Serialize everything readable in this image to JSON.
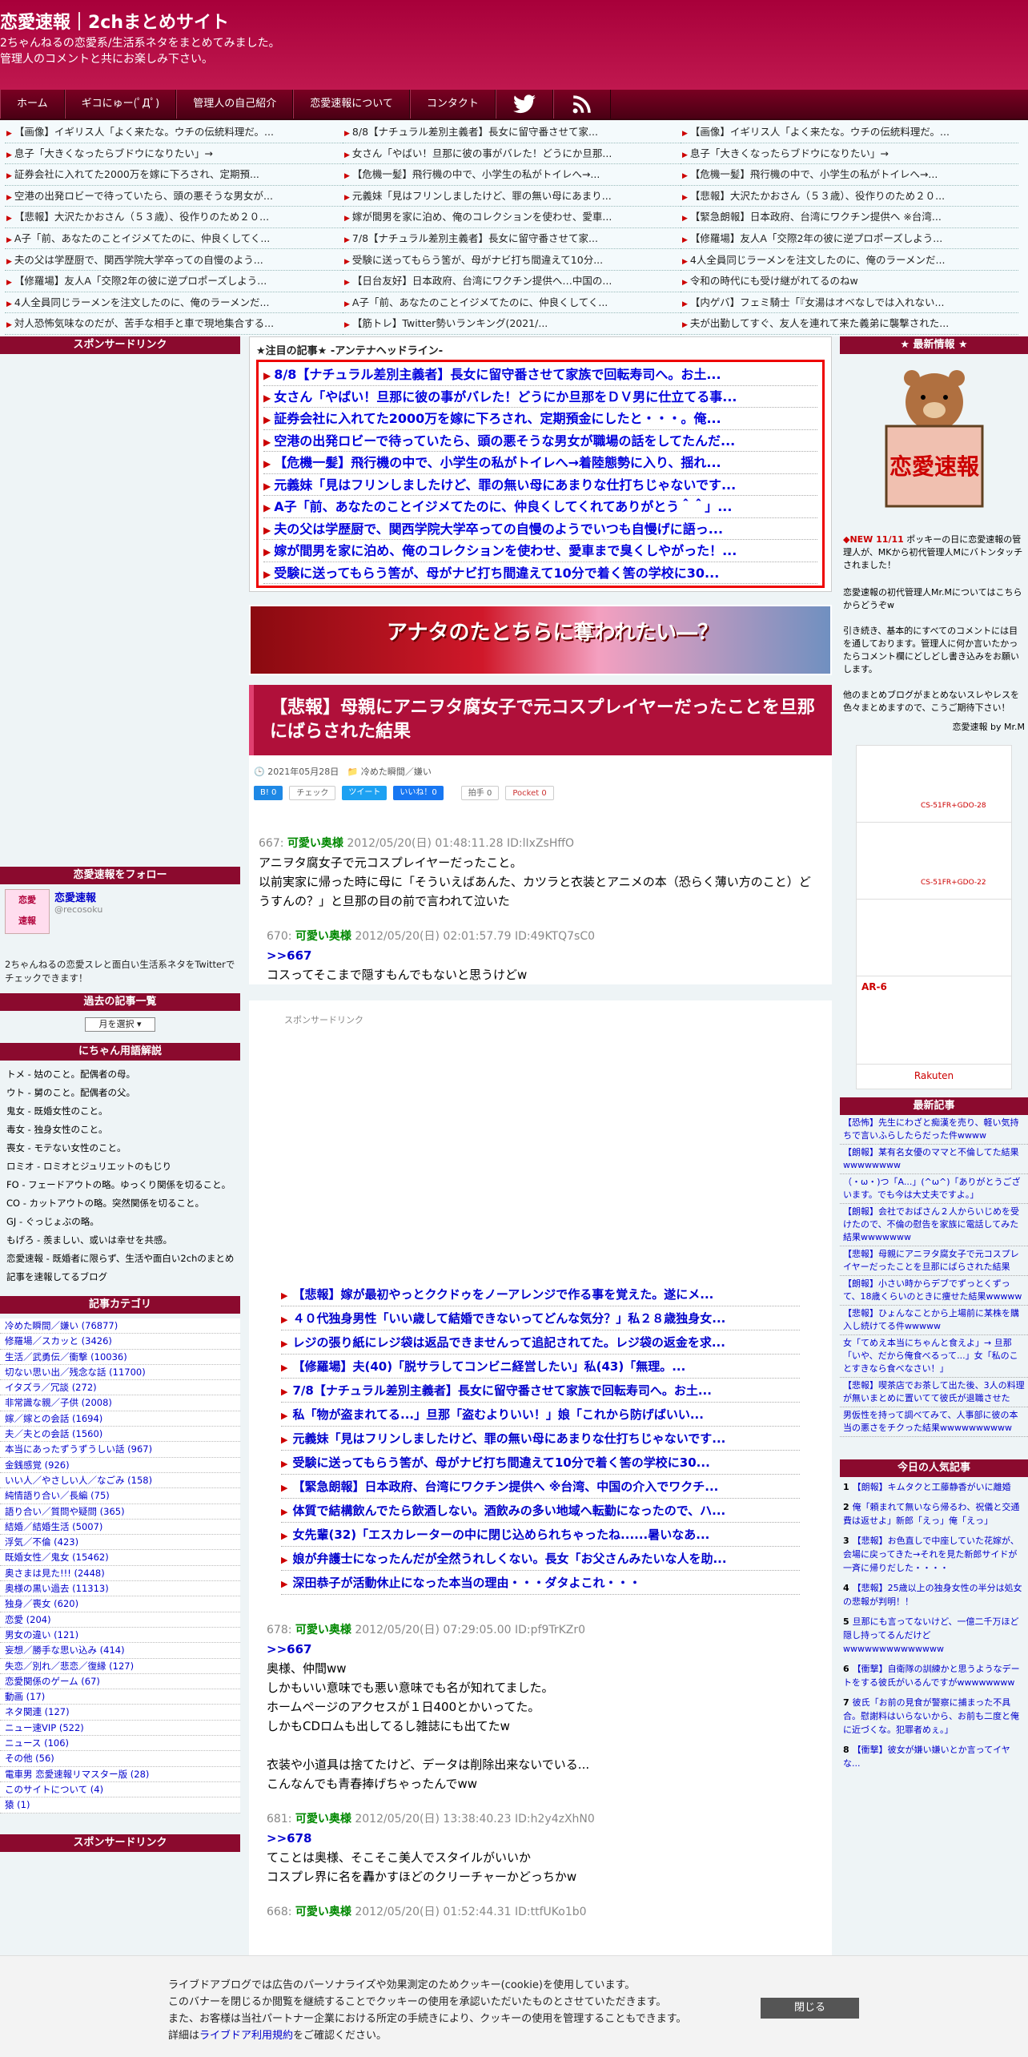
{
  "site": {
    "title": "恋愛速報｜2chまとめサイト",
    "desc1": "2ちゃんねるの恋愛系/生活系ネタをまとめてみました。",
    "desc2": "管理人のコメントと共にお楽しみ下さい。"
  },
  "nav": [
    "ホーム",
    "ギコにゅー(ﾟДﾟ)",
    "管理人の自己紹介",
    "恋愛速報について",
    "コンタクト"
  ],
  "ticker": [
    "【画像】イギリス人「よく来たな。ウチの伝統料理だ。...",
    "8/8【ナチュラル差別主義者】長女に留守番させて家...",
    "【画像】イギリス人「よく来たな。ウチの伝統料理だ。...",
    "息子「大きくなったらブドウになりたい」→",
    "女さん「やばい！旦那に彼の事がバレた！どうにか旦那...",
    "息子「大きくなったらブドウになりたい」→",
    "証券会社に入れてた2000万を嫁に下ろされ、定期預...",
    "【危機一髪】飛行機の中で、小学生の私がトイレへ→...",
    "【危機一髪】飛行機の中で、小学生の私がトイレへ→...",
    "空港の出発ロビーで待っていたら、頭の悪そうな男女が...",
    "元義妹「見はフリンしましたけど、罪の無い母にあまり...",
    "【悲報】大沢たかおさん（５３歳）、役作りのため２０...",
    "【悲報】大沢たかおさん（５３歳）、役作りのため２０...",
    "嫁が間男を家に泊め、俺のコレクションを使わせ、愛車...",
    "【緊急朗報】日本政府、台湾にワクチン提供へ ※台湾...",
    "A子「前、あなたのことイジメてたのに、仲良くしてく...",
    "7/8【ナチュラル差別主義者】長女に留守番させて家...",
    "【修羅場】友人A「交際2年の彼に逆プロポーズしよう...",
    "夫の父は学歴厨で、関西学院大学卒っての自慢のよう...",
    "受験に送ってもらう筈が、母がナビ打ち間違えて10分...",
    "4人全員同じラーメンを注文したのに、俺のラーメンだ...",
    "【修羅場】友人A「交際2年の彼に逆プロポーズしよう...",
    "【日台友好】日本政府、台湾にワクチン提供へ…中国の...",
    "令和の時代にも受け継がれてるのねw",
    "4人全員同じラーメンを注文したのに、俺のラーメンだ...",
    "A子「前、あなたのことイジメてたのに、仲良くしてく...",
    "【内ゲバ】フェミ騎士「『女湯はオベなしでは入れない...",
    "対人恐怖気味なのだが、苦手な相手と車で現地集合する...",
    "【筋トレ】Twitter勢いランキング(2021/...",
    "夫が出勤してすぐ、友人を連れて来た義弟に襲撃された..."
  ],
  "left": {
    "sponsor": "スポンサードリンク",
    "follow": "恋愛速報をフォロー",
    "acct_name": "恋愛速報",
    "acct_id": "@recosoku",
    "follow_desc": "2ちゃんねるの恋愛スレと面白い生活系ネタをTwitterでチェックできます！",
    "archive": "過去の記事一覧",
    "month_select": "月を選択",
    "glossary": "にちゃん用語解説",
    "terms": [
      "トメ - 姑のこと。配偶者の母。",
      "ウト - 舅のこと。配偶者の父。",
      "鬼女 - 既婚女性のこと。",
      "毒女 - 独身女性のこと。",
      "喪女 - モテない女性のこと。",
      "ロミオ - ロミオとジュリエットのもじり",
      "FO - フェードアウトの略。ゆっくり関係を切ること。",
      "CO - カットアウトの略。突然関係を切ること。",
      "GJ - ぐっじょぶの略。",
      "もげろ - 羨ましい、或いは幸せを共感。",
      "恋愛速報 - 既婚者に限らず、生活や面白い2chのまとめ記事を速報してるブログ"
    ],
    "category": "記事カテゴリ",
    "cats": [
      "冷めた瞬間／嫌い (76877)",
      "修羅場／スカッと (3426)",
      "生活／武勇伝／衝撃 (10036)",
      "切ない思い出／残念な話 (11700)",
      "イタズラ／冗談 (272)",
      "非常識な親／子供 (2008)",
      "嫁／嫁との会話 (1694)",
      "夫／夫との会話 (1560)",
      "本当にあったずうずうしい話 (967)",
      "金銭感覚 (926)",
      "いい人／やさしい人／なごみ (158)",
      "純情語り合い／長編 (75)",
      "語り合い／質問や疑問 (365)",
      "結婚／結婚生活 (5007)",
      "浮気／不倫 (423)",
      "既婚女性／鬼女 (15462)",
      "奥さまは見た!!! (2448)",
      "奥様の黒い過去 (11313)",
      "独身／喪女 (620)",
      "恋愛 (204)",
      "男女の違い (121)",
      "妄想／勝手な思い込み (414)",
      "失恋／別れ／悲恋／復縁 (127)",
      "恋愛関係のゲーム (67)",
      "動画 (17)",
      "ネタ関連 (127)",
      "ニュー速VIP (522)",
      "ニュース (106)",
      "その他 (56)",
      "電車男 恋愛速報リマスター版 (28)",
      "このサイトについて (4)",
      "猿 (1)"
    ],
    "sponsor2": "スポンサードリンク"
  },
  "antena": {
    "head": "★注目の記事★ -アンテナヘッドライン-",
    "items": [
      "8/8【ナチュラル差別主義者】長女に留守番させて家族で回転寿司へ。お土...",
      "女さん「やばい！旦那に彼の事がバレた！どうにか旦那をＤＶ男に仕立てる事...",
      "証券会社に入れてた2000万を嫁に下ろされ、定期預金にしたと・・・。俺...",
      "空港の出発ロビーで待っていたら、頭の悪そうな男女が職場の話をしてたんだ...",
      "【危機一髪】飛行機の中で、小学生の私がトイレへ→着陸態勢に入り、揺れ...",
      "元義妹「見はフリンしましたけど、罪の無い母にあまりな仕打ちじゃないです...",
      "A子「前、あなたのことイジメてたのに、仲良くしてくれてありがとう＾＾」...",
      "夫の父は学歴厨で、関西学院大学卒っての自慢のようでいつも自慢げに語っ...",
      "嫁が間男を家に泊め、俺のコレクションを使わせ、愛車まで臭くしやがった！...",
      "受験に送ってもらう筈が、母がナビ打ち間違えて10分で着く筈の学校に30..."
    ]
  },
  "banner_text": "アナタのたとちらに奪われたい―？",
  "article": {
    "title": "【悲報】母親にアニヲタ腐女子で元コスプレイヤーだったことを旦那にばらされた結果",
    "date": "2021年05月28日",
    "category": "冷めた瞬間／嫌い",
    "b": "B! 0",
    "check": "チェック",
    "tweet": "ツイート",
    "like": "いいね！0",
    "hakushu": "拍手 0",
    "pocket": "Pocket 0"
  },
  "posts": [
    {
      "no": "667:",
      "name": "可愛い奥様",
      "date": "2012/05/20(日) 01:48:11.28 ID:lIxZsHffO",
      "ref": "",
      "lines": [
        "アニヲタ腐女子で元コスプレイヤーだったこと。",
        "以前実家に帰った時に母に「そういえばあんた、カツラと衣装とアニメの本（恐らく薄い方のこと）どうすんの？」と旦那の目の前で言われて泣いた"
      ]
    },
    {
      "no": "670:",
      "name": "可愛い奥様",
      "date": "2012/05/20(日) 02:01:57.79 ID:49KTQ7sC0",
      "ref": ">>667",
      "lines": [
        "コスってそこまで隠すもんでもないと思うけどw"
      ]
    }
  ],
  "ad_label": "スポンサードリンク",
  "mid_links": [
    "【悲報】嫁が最初やっとククドゥをノーアレンジで作る事を覚えた。遂にメ...",
    "４０代独身男性「いい歳して結婚できないってどんな気分？」私２８歳独身女...",
    "レジの張り紙にレジ袋は返品できませんって追記されてた。レジ袋の返金を求...",
    "【修羅場】夫(40)「脱サラしてコンビニ経営したい」私(43)「無理。...",
    "7/8【ナチュラル差別主義者】長女に留守番させて家族で回転寿司へ。お土...",
    "私「物が盗まれてる...」旦那「盗むよりいい！」娘「これから防げばいい...",
    "元義妹「見はフリンしましたけど、罪の無い母にあまりな仕打ちじゃないです...",
    "受験に送ってもらう筈が、母がナビ打ち間違えて10分で着く筈の学校に30...",
    "【緊急朗報】日本政府、台湾にワクチン提供へ ※台湾、中国の介入でワクチ...",
    "体質で結構飲んでたら飲酒しない。酒飲みの多い地域へ転勤になったので、ハ...",
    "女先輩(32)「エスカレーターの中に閉じ込められちゃったね......暑いなあ...",
    "娘が弁護士になったんだが全然うれしくない。長女「お父さんみたいな人を助...",
    "深田恭子が活動休止になった本当の理由・・・ダタよこれ・・・"
  ],
  "posts2": [
    {
      "no": "678:",
      "name": "可愛い奥様",
      "date": "2012/05/20(日) 07:29:05.00 ID:pf9TrKZr0",
      "ref": ">>667",
      "lines": [
        "奥様、仲間ww",
        "しかもいい意味でも悪い意味でも名が知れてました。",
        "ホームページのアクセスが１日400とかいってた。",
        "しかもCDロムも出してるし雑誌にも出てたw",
        "",
        "衣装や小道具は捨てたけど、データは削除出来ないでいる...",
        "こんなんでも青春捧げちゃったんでww"
      ]
    },
    {
      "no": "681:",
      "name": "可愛い奥様",
      "date": "2012/05/20(日) 13:38:40.23 ID:h2y4zXhN0",
      "ref": ">>678",
      "lines": [
        "てことは奥様、そこそこ美人でスタイルがいいか",
        "コスプレ界に名を轟かすほどのクリーチャーかどっちかw"
      ]
    },
    {
      "no": "668:",
      "name": "可愛い奥様",
      "date": "2012/05/20(日) 01:52:44.31 ID:ttfUKo1b0",
      "ref": "",
      "lines": []
    }
  ],
  "right": {
    "latest": "★ 最新情報 ★",
    "logo_text": "恋愛速報",
    "news_new": "◆NEW 11/11",
    "news_body": "ポッキーの日に恋愛速報の管理人が、MKから初代管理人Mにバトンタッチされました！",
    "intro1": "恋愛速報の初代管理人Mr.Mについてはこちらからどうぞw",
    "intro2": "引き続き、基本的にすべてのコメントには目を通しております。管理人に何か言いたかったらコメント欄にどしどし書き込みをお願いします。",
    "intro3": "他のまとめブログがまとめないスレやレスを色々まとめますので、こうご期待下さい！",
    "sign": "恋愛速報 by Mr.M",
    "products": [
      "CS-51FR+GDO-28",
      "CS-51FR+GDO-22",
      "AR-6",
      "Rakuten"
    ],
    "latest_posts": "最新記事",
    "new_items": [
      "【恐怖】先生にわざと痴漢を売り、軽い気持ちで言いふらしたらだった件wwww",
      "【朗報】某有名女優のママと不倫してた結果wwwwwwww",
      "（・ω・)つ「A...」(^ω^)「ありがとうございます。でも今は大丈夫ですよ。」",
      "【朗報】会社でおばさん２人からいじめを受けたので、不倫の慰告を家族に電話してみた結果wwwwwww",
      "【悲報】母親にアニヲタ腐女子で元コスプレイヤーだったことを旦那にばらされた結果",
      "【朗報】小さい時からデブでずっとくずって、18歳くらいのときに痩せた結果wwwww",
      "【悲報】ひょんなことから上場前に某株を購入し続けてる件wwwww",
      "女「てめえ本当にちゃんと食えよ」→ 旦那「いや、だから俺食べるって...」女「私のことすきなら食べなさい！」",
      "【悲報】喫茶店でお茶して出た後、3人の料理が無いまとめに置いてて彼氏が退職させた",
      "男仮性を持って調べてみて、人事部に彼の本当の悪さをチクった結果wwwwwwwwww"
    ],
    "ranking": "今日の人気記事",
    "rank_items": [
      "【朗報】キムタクと工藤静香がいに離婚",
      "俺「頼まれて無いなら帰るわ、祝儀と交通費は返せよ」新郎「えっ」俺「えっ」",
      "【悲報】お色直しで中座していた花嫁が、会場に戻ってきた→それを見た新郎サイドが一斉に帰りだした・・・・",
      "【悲報】25歳以上の独身女性の半分は処女の悲報が判明！！",
      "旦那にも言ってないけど、一億二千万ほど隠し持ってるんだけどwwwwwwwwwwwwww",
      "【衝撃】自衛隊の訓練かと思うようなデートをする彼氏がいるんですがwwwwwwww",
      "彼氏「お前の見食が警察に捕まった不具合。慰謝料はいらないから、お前も二度と俺に近づくな。犯罪者めぇ。」",
      "【衝撃】彼女が嫌い嫌いとか言ってイヤな..."
    ]
  },
  "cookie": {
    "l1": "ライブドアブログでは広告のパーソナライズや効果測定のためクッキー(cookie)を使用しています。",
    "l2": "このバナーを閉じるか閲覧を継続することでクッキーの使用を承認いただいたものとさせていただきます。",
    "l3": "また、お客様は当社パートナー企業における所定の手続きにより、クッキーの使用を管理することもできます。",
    "l4a": "詳細は",
    "l4link": "ライブドア利用規約",
    "l4b": "をご確認ください。",
    "close": "閉じる"
  }
}
